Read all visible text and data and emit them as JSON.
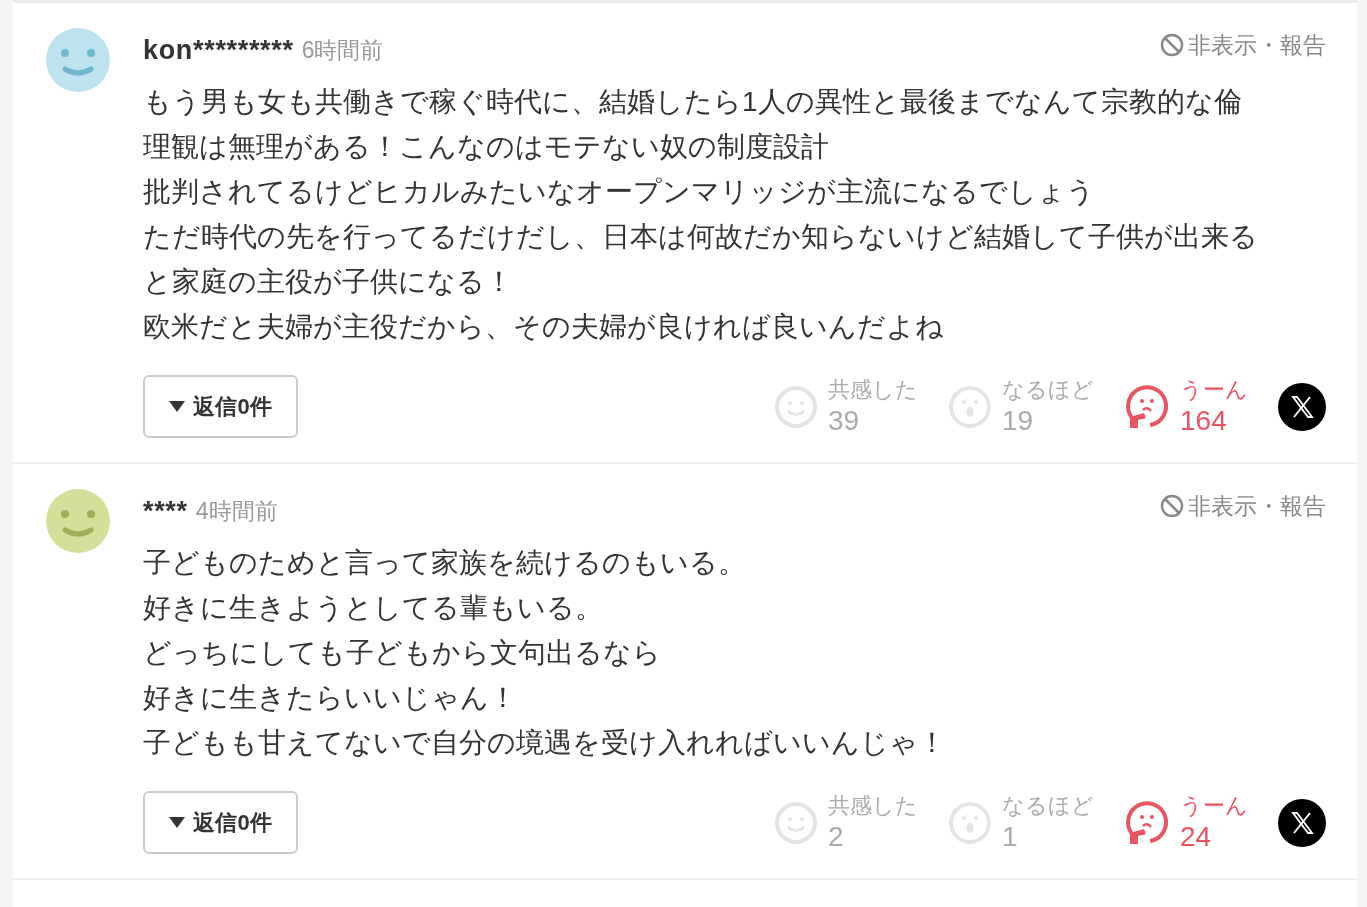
{
  "comments": [
    {
      "user": "kon*********",
      "time": "6時間前",
      "avatar": {
        "color": "#bde3f0"
      },
      "report": "非表示・報告",
      "body": [
        "もう男も女も共働きで稼ぐ時代に、結婚したら1人の異性と最後までなんて宗教的な倫",
        "理観は無理がある！こんなのはモテない奴の制度設計",
        "批判されてるけどヒカルみたいなオープンマリッジが主流になるでしょう",
        "ただ時代の先を行ってるだけだし、日本は何故だか知らないけど結婚して子供が出来る",
        "と家庭の主役が子供になる！",
        "欧米だと夫婦が主役だから、その夫婦が良ければ良いんだよね"
      ],
      "reply": "返信0件",
      "reactions": [
        {
          "kind": "smile",
          "label": "共感した",
          "count": "39",
          "selected": false
        },
        {
          "kind": "surprise",
          "label": "なるほど",
          "count": "19",
          "selected": false
        },
        {
          "kind": "think",
          "label": "うーん",
          "count": "164",
          "selected": true
        }
      ]
    },
    {
      "user": "****",
      "time": "4時間前",
      "avatar": {
        "color": "#d3e09a"
      },
      "report": "非表示・報告",
      "body": [
        "子どものためと言って家族を続けるのもいる。",
        "好きに生きようとしてる輩もいる。",
        "どっちにしても子どもから文句出るなら",
        "好きに生きたらいいじゃん！",
        "子どもも甘えてないで自分の境遇を受け入れればいいんじゃ！"
      ],
      "reply": "返信0件",
      "reactions": [
        {
          "kind": "smile",
          "label": "共感した",
          "count": "2",
          "selected": false
        },
        {
          "kind": "surprise",
          "label": "なるほど",
          "count": "1",
          "selected": false
        },
        {
          "kind": "think",
          "label": "うーん",
          "count": "24",
          "selected": true
        }
      ]
    }
  ]
}
